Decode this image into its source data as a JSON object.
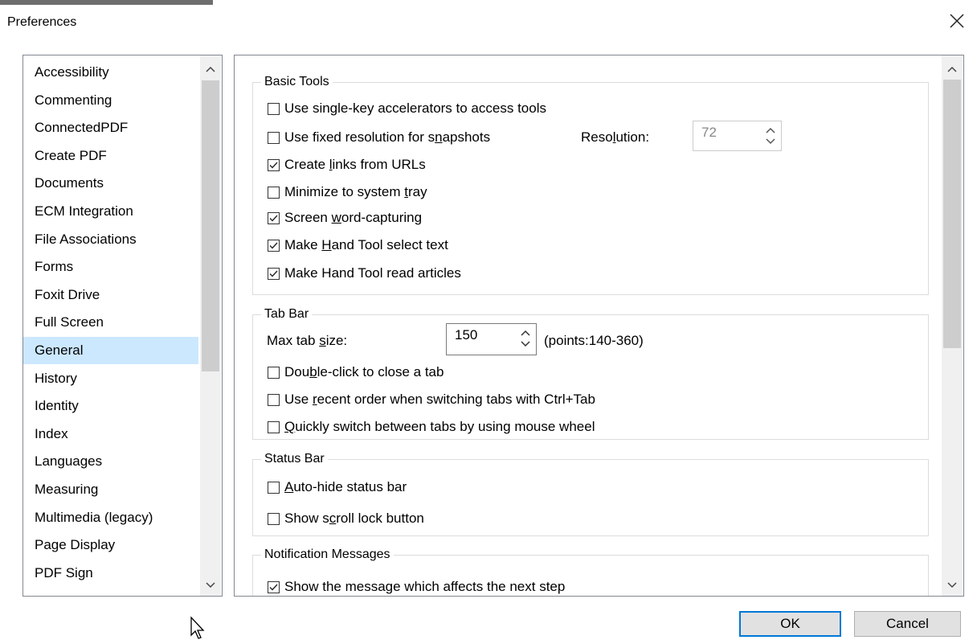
{
  "window": {
    "title": "Preferences"
  },
  "categories": [
    "Accessibility",
    "Commenting",
    "ConnectedPDF",
    "Create PDF",
    "Documents",
    "ECM Integration",
    "File Associations",
    "Forms",
    "Foxit Drive",
    "Full Screen",
    "General",
    "History",
    "Identity",
    "Index",
    "Languages",
    "Measuring",
    "Multimedia (legacy)",
    "Page Display",
    "PDF Sign"
  ],
  "selected_category": "General",
  "basic_tools": {
    "label": "Basic Tools",
    "single_key": {
      "label": "Use single-key accelerators to access tools",
      "checked": false
    },
    "fixed_res": {
      "label_pre": "Use fixed resolution for s",
      "label_u": "n",
      "label_post": "apshots",
      "checked": false
    },
    "resolution_label_pre": "Reso",
    "resolution_label_u": "l",
    "resolution_label_post": "ution:",
    "resolution_value": "72",
    "links": {
      "label_pre": "Create ",
      "label_u": "l",
      "label_post": "inks from URLs",
      "checked": true
    },
    "minimize": {
      "label_pre": "Minimize to system ",
      "label_u": "t",
      "label_post": "ray",
      "checked": false
    },
    "word_capture": {
      "label_pre": "Screen ",
      "label_u": "w",
      "label_post": "ord-capturing",
      "checked": true
    },
    "hand_select": {
      "label_pre": "Make ",
      "label_u": "H",
      "label_post": "and Tool select text",
      "checked": true
    },
    "hand_read": {
      "label": "Make Hand Tool read articles",
      "checked": true
    }
  },
  "tab_bar": {
    "label": "Tab Bar",
    "max_size_pre": "Max tab ",
    "max_size_u": "s",
    "max_size_post": "ize:",
    "max_size_value": "150",
    "range_note": "(points:140-360)",
    "dblclick": {
      "label_pre": "Dou",
      "label_u": "b",
      "label_post": "le-click to close a tab",
      "checked": false
    },
    "recent": {
      "label_pre": "Use ",
      "label_u": "r",
      "label_post": "ecent order when switching tabs with Ctrl+Tab",
      "checked": false
    },
    "wheel": {
      "label_pre": "",
      "label_u": "Q",
      "label_post": "uickly switch between tabs by using mouse wheel",
      "checked": false
    }
  },
  "status_bar": {
    "label": "Status Bar",
    "autohide": {
      "label_pre": "",
      "label_u": "A",
      "label_post": "uto-hide status bar",
      "checked": false
    },
    "scroll_lock": {
      "label_pre": "Show s",
      "label_u": "c",
      "label_post": "roll lock button",
      "checked": false
    }
  },
  "notifications": {
    "label": "Notification Messages",
    "next_step": {
      "label": "Show the message which affects the next step",
      "checked": true
    }
  },
  "buttons": {
    "ok": "OK",
    "cancel": "Cancel"
  },
  "icons": {
    "close": "close-icon",
    "check": "check-icon",
    "scroll_up": "chevron-up-icon",
    "scroll_down": "chevron-down-icon",
    "spin": "spinner-arrows-icon",
    "cursor": "mouse-pointer-icon"
  }
}
